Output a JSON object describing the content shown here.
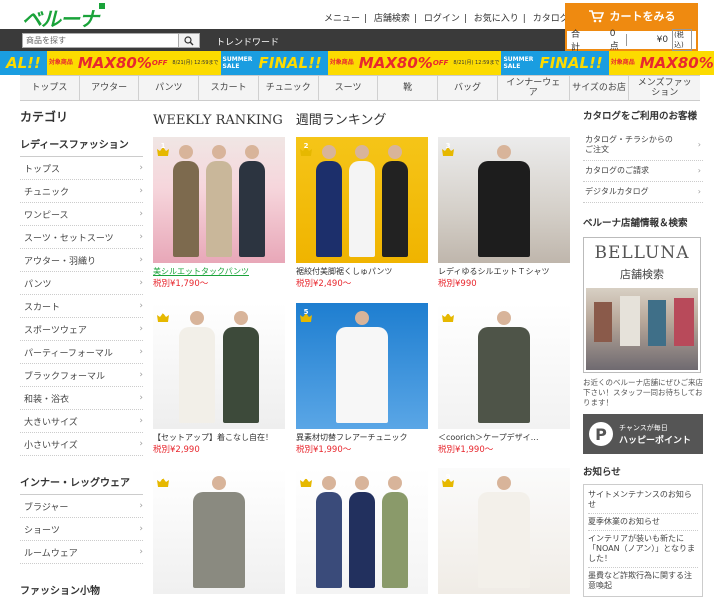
{
  "header": {
    "logo": "ベルーナ",
    "nav": [
      "メニュー",
      "店舗検索",
      "ログイン",
      "お気に入り",
      "カタログ"
    ],
    "cart_button": "カートをみる",
    "cart": {
      "total_label": "合計",
      "count": "0点",
      "amount": "¥0",
      "tax": "(税込)"
    }
  },
  "search": {
    "placeholder": "商品を探す",
    "trend": "トレンドワード"
  },
  "banner": {
    "final": "FINAL!!",
    "summer_sale": "SUMMER SALE",
    "max": "MAX80%",
    "off": "OFF",
    "date": "8/21(月) 12:59まで",
    "tag": "対象商品"
  },
  "category_nav": [
    "トップス",
    "アウター",
    "パンツ",
    "スカート",
    "チュニック",
    "スーツ",
    "靴",
    "バッグ",
    "インナーウェア",
    "サイズのお店",
    "メンズファッション"
  ],
  "left": {
    "title": "カテゴリ",
    "section1": "レディースファッション",
    "items1": [
      "トップス",
      "チュニック",
      "ワンピース",
      "スーツ・セットスーツ",
      "アウター・羽織り",
      "パンツ",
      "スカート",
      "スポーツウェア",
      "パーティーフォーマル",
      "ブラックフォーマル",
      "和装・浴衣",
      "大きいサイズ",
      "小さいサイズ"
    ],
    "section2": "インナー・レッグウェア",
    "items2": [
      "ブラジャー",
      "ショーツ",
      "ルームウェア"
    ],
    "section3": "ファッション小物"
  },
  "ranking": {
    "title": "WEEKLY RANKING　週間ランキング",
    "items": [
      {
        "rank": "1",
        "name": "美シルエットタックパンツ",
        "price": "税別¥1,790～"
      },
      {
        "rank": "2",
        "name": "裾絞付美脚裾くしゅパンツ",
        "price": "税別¥2,490～"
      },
      {
        "rank": "3",
        "name": "レディゆるシルエットＴシャツ",
        "price": "税別¥990"
      },
      {
        "rank": "4",
        "name": "【セットアップ】着こなし自在！",
        "price": "税別¥2,990"
      },
      {
        "rank": "5",
        "name": "異素材切替フレアーチュニック",
        "price": "税別¥1,990～"
      },
      {
        "rank": "6",
        "name": "＜coorich＞ケープデザイ…",
        "price": "税別¥1,990～"
      },
      {
        "rank": "7",
        "name": "",
        "price": ""
      },
      {
        "rank": "8",
        "name": "",
        "price": ""
      },
      {
        "rank": "9",
        "name": "",
        "price": ""
      }
    ]
  },
  "right": {
    "catalog_title": "カタログをご利用のお客様",
    "catalog_items": [
      "カタログ・チラシからのご注文",
      "カタログのご請求",
      "デジタルカタログ"
    ],
    "store_title": "ベルーナ店舗情報＆検索",
    "store_logo": "BELLUNA",
    "store_sub": "店舗検索",
    "store_text": "お近くのベルーナ店舗にぜひご来店下さい！スタッフ一同お待ちしております！",
    "happy_small": "チャンスが毎日",
    "happy_big": "ハッピーポイント",
    "news_title": "お知らせ",
    "news": [
      "サイトメンテナンスのお知らせ",
      "夏季休業のお知らせ",
      "インテリアが装いも新たに「NOAN（ノアン）」となりました！",
      "墨費など詐欺行為に関する注意喚起"
    ]
  }
}
